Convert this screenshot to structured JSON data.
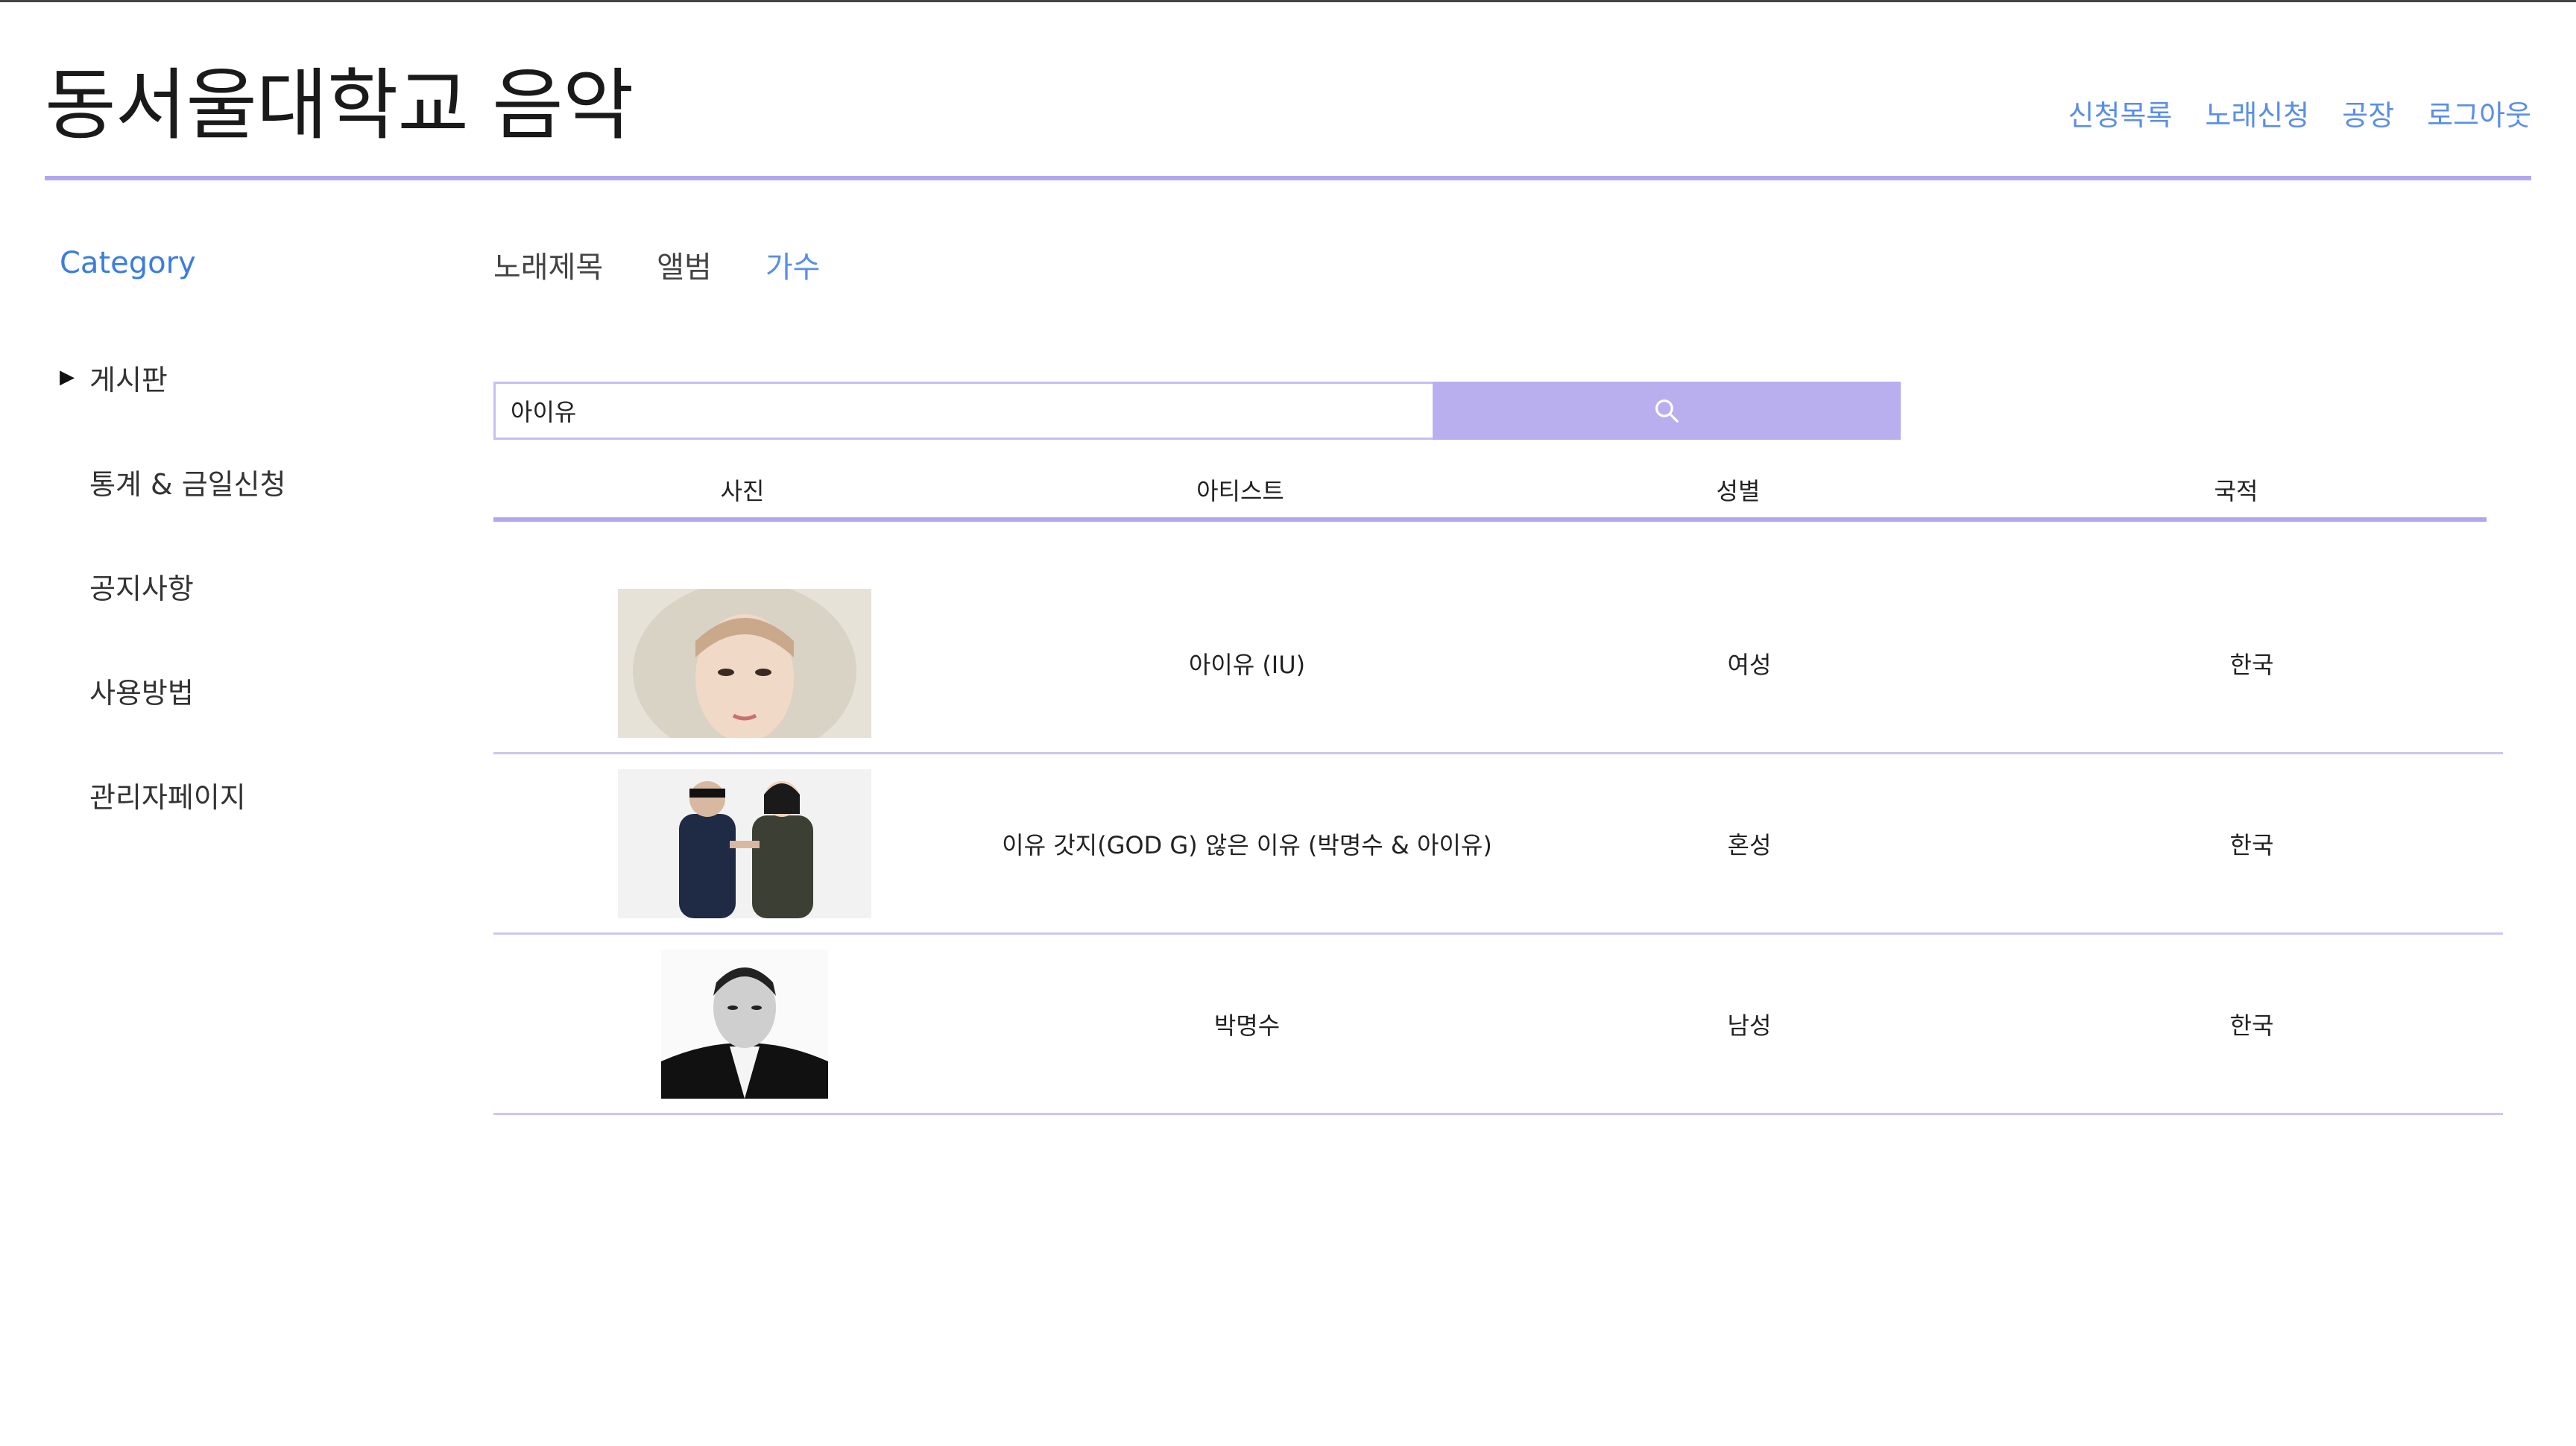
{
  "site": {
    "title": "동서울대학교 음악",
    "nav": [
      {
        "label": "신청목록"
      },
      {
        "label": "노래신청"
      },
      {
        "label": "공장"
      },
      {
        "label": "로그아웃"
      }
    ]
  },
  "sidebar": {
    "heading": "Category",
    "items": [
      {
        "label": "게시판",
        "has_caret": true
      },
      {
        "label": "통계 & 금일신청"
      },
      {
        "label": "공지사항"
      },
      {
        "label": "사용방법"
      },
      {
        "label": "관리자페이지"
      }
    ]
  },
  "tabs": {
    "items": [
      {
        "label": "노래제목"
      },
      {
        "label": "앨범"
      },
      {
        "label": "가수",
        "active": true
      }
    ]
  },
  "search": {
    "value": "아이유",
    "button_icon": "search-icon"
  },
  "table": {
    "columns": [
      "사진",
      "아티스트",
      "성별",
      "국적"
    ],
    "rows": [
      {
        "photo": "IU portrait with fur hood",
        "artist": "아이유 (IU)",
        "gender": "여성",
        "nationality": "한국"
      },
      {
        "photo": "Duo in dark jackets pointing",
        "artist": "이유 갓지(GOD G) 않은 이유 (박명수 & 아이유)",
        "gender": "혼성",
        "nationality": "한국"
      },
      {
        "photo": "Man in suit black and white",
        "artist": "박명수",
        "gender": "남성",
        "nationality": "한국"
      }
    ]
  },
  "colors": {
    "accent": "#b2a7ef",
    "link": "#5a8ee8",
    "button": "#b9afef"
  }
}
